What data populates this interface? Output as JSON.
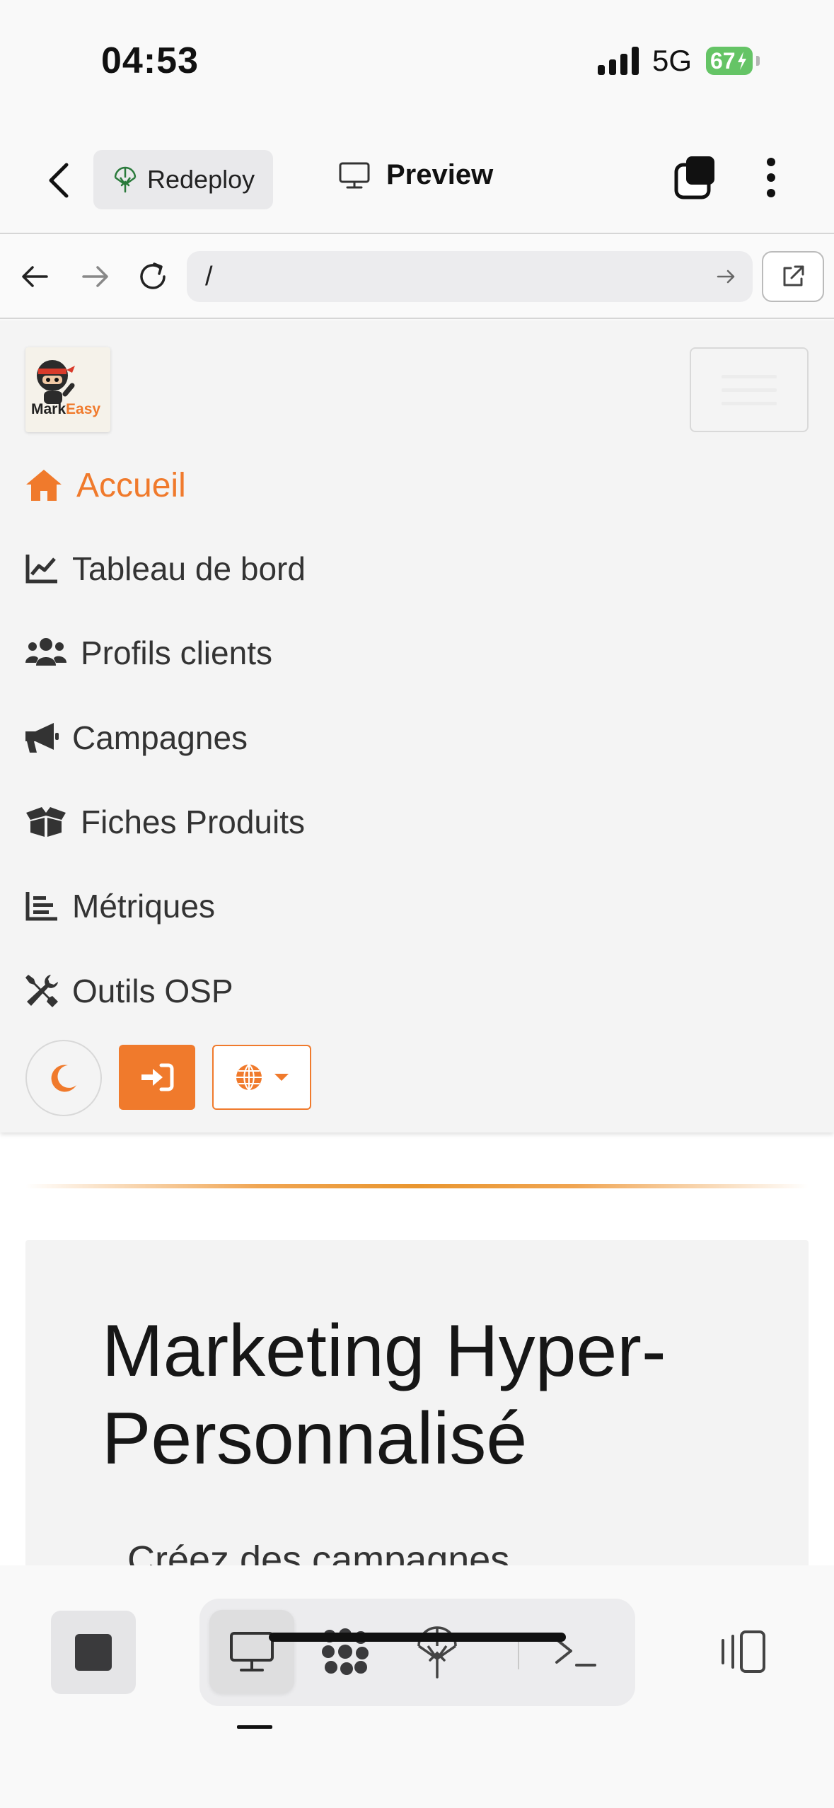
{
  "status_bar": {
    "time": "04:53",
    "network": "5G",
    "battery": "67"
  },
  "app_header": {
    "redeploy_label": "Redeploy",
    "preview_label": "Preview"
  },
  "url_bar": {
    "url": "/"
  },
  "site": {
    "logo_text_primary": "Mark",
    "logo_text_accent": "Easy",
    "menu": [
      {
        "label": "Accueil",
        "icon": "home-icon",
        "active": true
      },
      {
        "label": "Tableau de bord",
        "icon": "chart-line-icon",
        "active": false
      },
      {
        "label": "Profils clients",
        "icon": "users-icon",
        "active": false
      },
      {
        "label": "Campagnes",
        "icon": "megaphone-icon",
        "active": false
      },
      {
        "label": "Fiches Produits",
        "icon": "box-open-icon",
        "active": false
      },
      {
        "label": "Métriques",
        "icon": "bar-chart-icon",
        "active": false
      },
      {
        "label": "Outils OSP",
        "icon": "tools-icon",
        "active": false
      }
    ],
    "hero": {
      "title": "Marketing Hyper-Personnalisé",
      "subtitle": "Créez des campagnes"
    },
    "colors": {
      "accent": "#f07a2c",
      "panel_bg": "#f4f4f4"
    }
  },
  "bottom_toolbar": {
    "active_tab": "desktop-preview",
    "icons": [
      "stop-icon",
      "desktop-icon",
      "logo-icon",
      "deploy-icon",
      "terminal-icon",
      "panel-toggle-icon"
    ]
  }
}
